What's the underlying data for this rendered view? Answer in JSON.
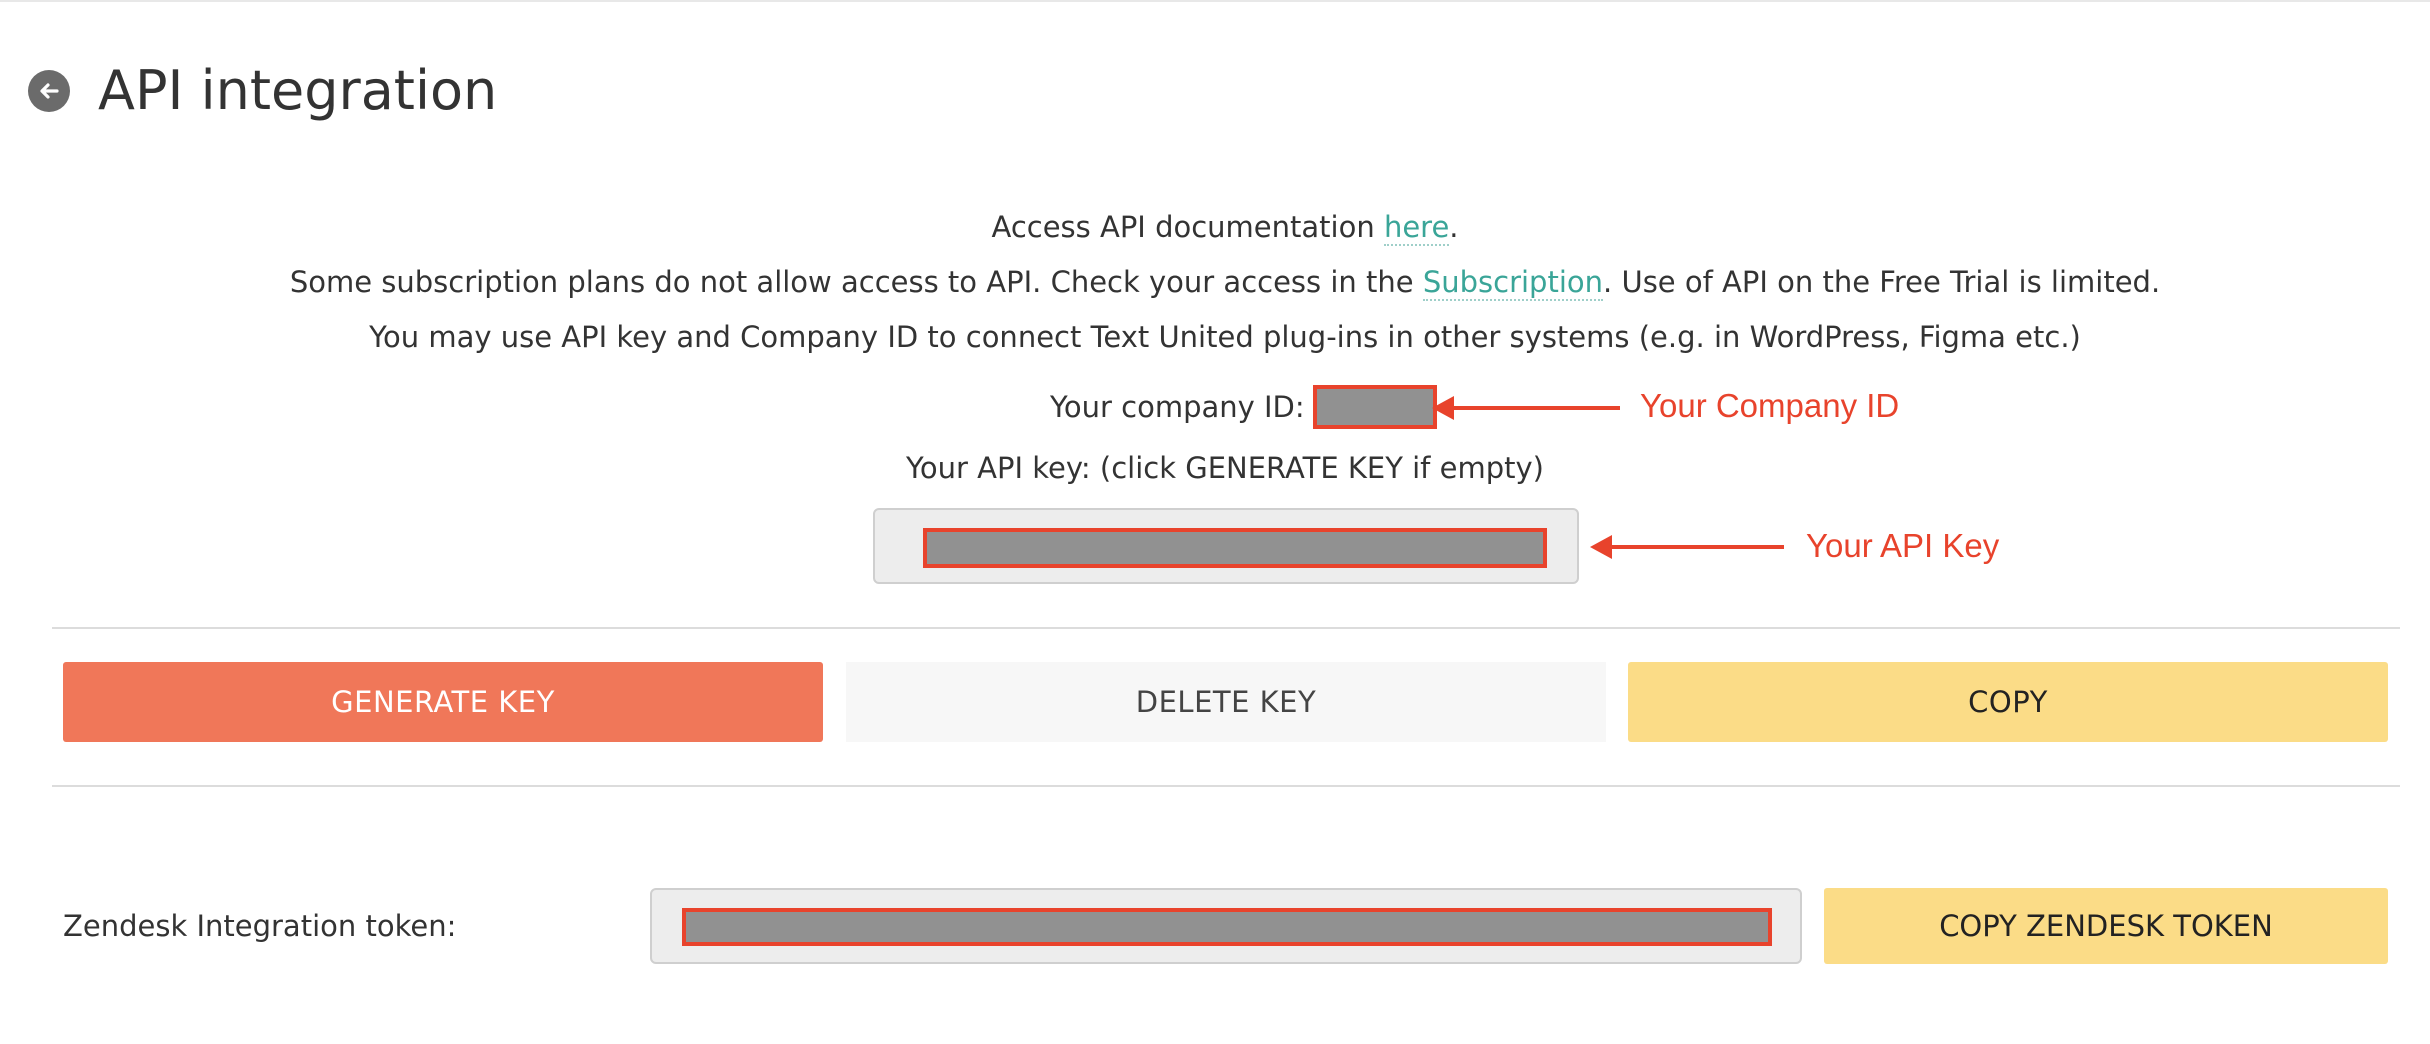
{
  "header": {
    "title": "API integration",
    "back_icon": "arrow-left-circle-icon"
  },
  "info": {
    "doc_prefix": "Access API documentation ",
    "doc_link": "here",
    "doc_suffix": ".",
    "plans_prefix": "Some subscription plans do not allow access to API. Check your access in the ",
    "plans_link": "Subscription",
    "plans_suffix": ". Use of API on the Free Trial is limited.",
    "plugins_text": "You may use API key and Company ID to connect Text United plug-ins in other systems (e.g. in WordPress, Figma etc.)"
  },
  "company": {
    "label": "Your company ID:"
  },
  "api_key": {
    "label": "Your API key: (click GENERATE KEY if empty)"
  },
  "annotations": {
    "company_id": "Your Company ID",
    "api_key": "Your API Key"
  },
  "actions": {
    "generate_label": "GENERATE KEY",
    "delete_label": "DELETE KEY",
    "copy_label": "COPY"
  },
  "zendesk": {
    "label": "Zendesk Integration token:",
    "copy_label": "COPY ZENDESK TOKEN"
  },
  "colors": {
    "accent_orange": "#f07759",
    "accent_yellow": "#fbdc87",
    "link_teal": "#3aa598",
    "annotation_red": "#e8432c"
  }
}
